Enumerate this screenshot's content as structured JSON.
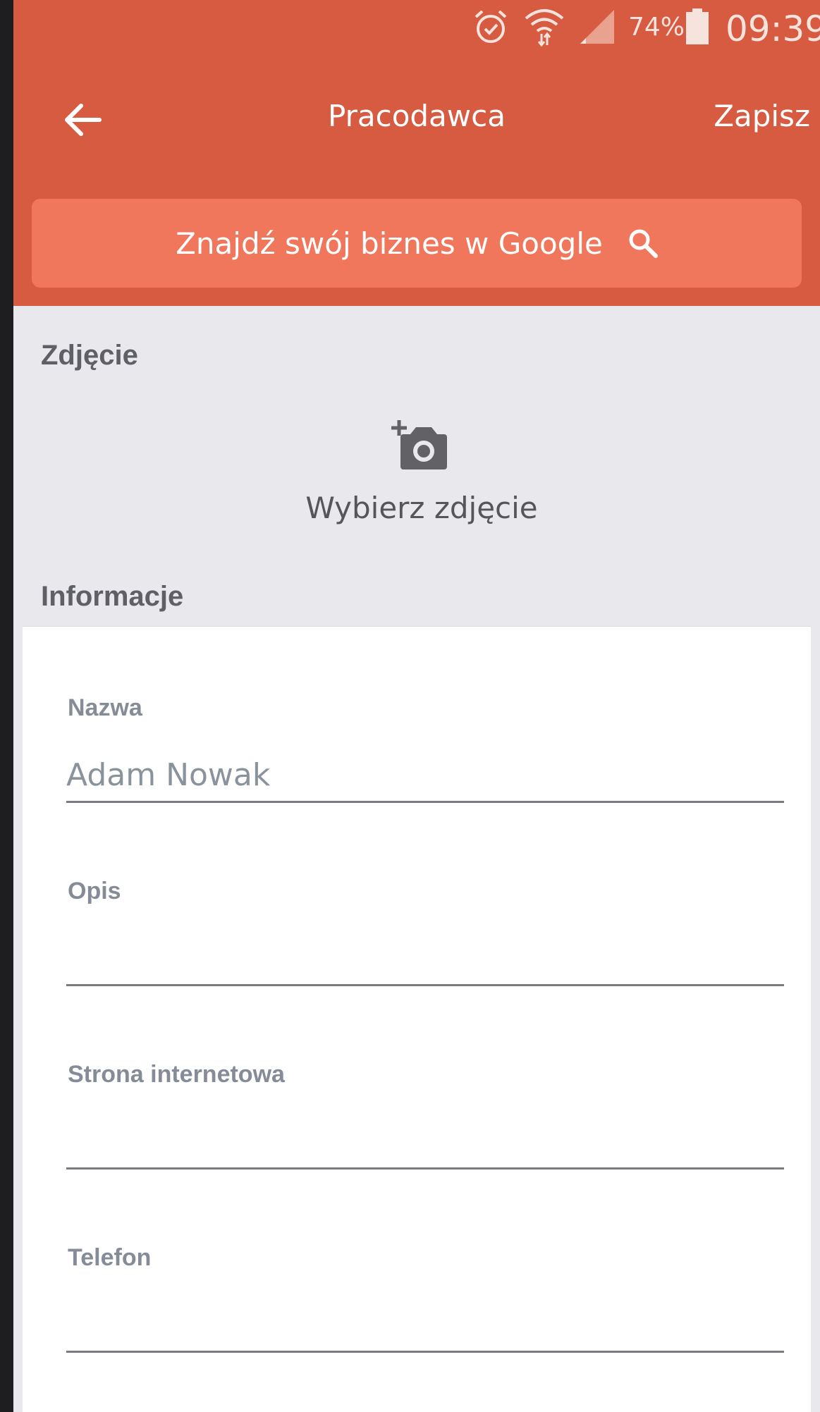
{
  "status_bar": {
    "battery_percent": "74%",
    "time": "09:39",
    "icons": [
      "alarm-icon",
      "wifi-icon",
      "signal-icon",
      "battery-icon"
    ]
  },
  "toolbar": {
    "title": "Pracodawca",
    "save_label": "Zapisz",
    "back_icon": "arrow-left-icon"
  },
  "google_search": {
    "label": "Znajdź swój biznes w Google",
    "icon": "search-icon"
  },
  "photo_section": {
    "heading": "Zdjęcie",
    "picker_label": "Wybierz zdjęcie",
    "icon": "add-photo-icon"
  },
  "info_section": {
    "heading": "Informacje",
    "fields": [
      {
        "label": "Nazwa",
        "value": "",
        "placeholder": "Adam Nowak"
      },
      {
        "label": "Opis",
        "value": "",
        "placeholder": ""
      },
      {
        "label": "Strona internetowa",
        "value": "",
        "placeholder": ""
      },
      {
        "label": "Telefon",
        "value": "",
        "placeholder": ""
      }
    ]
  },
  "colors": {
    "appbar": "#d65b40",
    "search_button": "#f0765c",
    "background": "#e9e8ed",
    "card": "#ffffff"
  }
}
